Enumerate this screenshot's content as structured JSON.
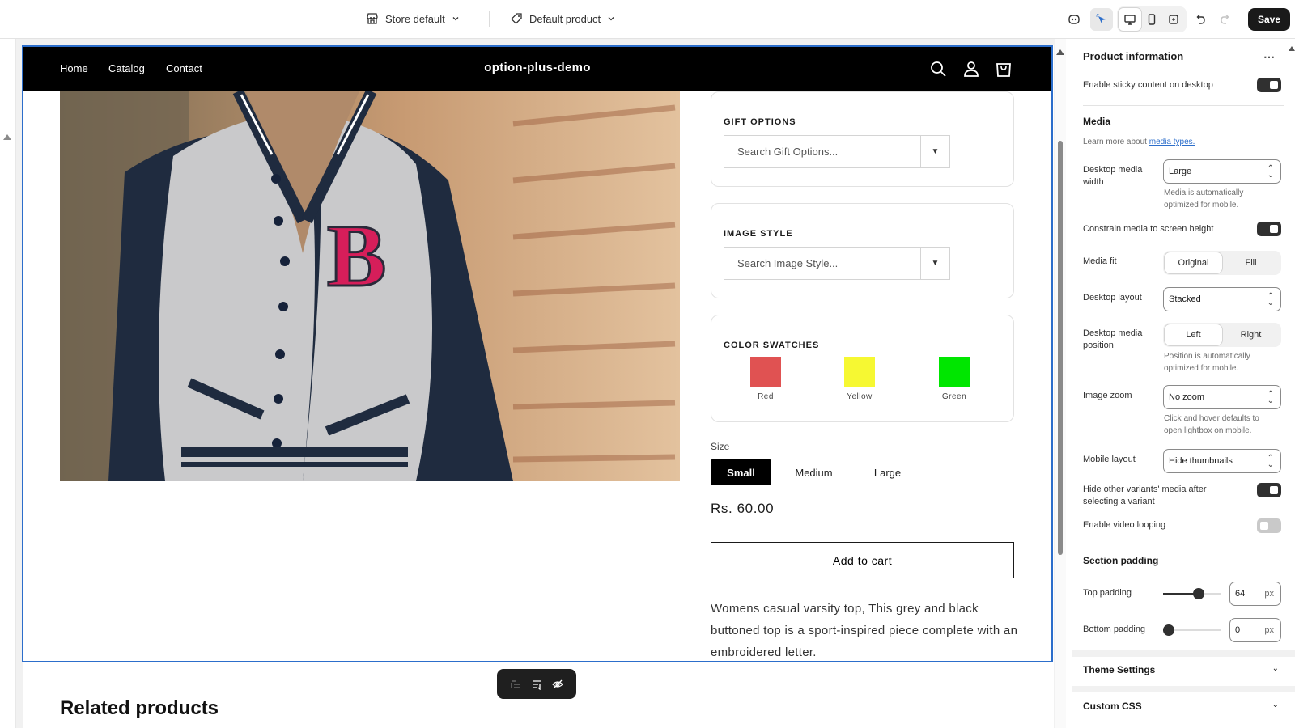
{
  "topbar": {
    "store_label": "Store default",
    "template_label": "Default product",
    "save_label": "Save"
  },
  "store": {
    "nav": [
      "Home",
      "Catalog",
      "Contact"
    ],
    "name": "option-plus-demo"
  },
  "product": {
    "gift_options": {
      "title": "GIFT OPTIONS",
      "placeholder": "Search Gift Options..."
    },
    "image_style": {
      "title": "IMAGE STYLE",
      "placeholder": "Search Image Style..."
    },
    "color_swatches": {
      "title": "COLOR SWATCHES",
      "items": [
        {
          "label": "Red",
          "color": "#e05252"
        },
        {
          "label": "Yellow",
          "color": "#f6f832"
        },
        {
          "label": "Green",
          "color": "#00e600"
        }
      ]
    },
    "size_label": "Size",
    "sizes": [
      "Small",
      "Medium",
      "Large"
    ],
    "selected_size": "Small",
    "price": "Rs. 60.00",
    "add_to_cart": "Add to cart",
    "description": "Womens casual varsity top, This grey and black buttoned top is a sport-inspired piece complete with an embroidered letter."
  },
  "related_title": "Related products",
  "panel": {
    "title": "Product information",
    "sticky_label": "Enable sticky content on desktop",
    "media_title": "Media",
    "learn_prefix": "Learn more about",
    "learn_link": "media types.",
    "desktop_media_width": {
      "label": "Desktop media width",
      "value": "Large",
      "help": "Media is automatically optimized for mobile."
    },
    "constrain_label": "Constrain media to screen height",
    "media_fit": {
      "label": "Media fit",
      "options": [
        "Original",
        "Fill"
      ],
      "selected": "Original"
    },
    "desktop_layout": {
      "label": "Desktop layout",
      "value": "Stacked"
    },
    "desktop_media_position": {
      "label": "Desktop media position",
      "options": [
        "Left",
        "Right"
      ],
      "selected": "Left",
      "help": "Position is automatically optimized for mobile."
    },
    "image_zoom": {
      "label": "Image zoom",
      "value": "No zoom",
      "help": "Click and hover defaults to open lightbox on mobile."
    },
    "mobile_layout": {
      "label": "Mobile layout",
      "value": "Hide thumbnails"
    },
    "hide_variants_label": "Hide other variants' media after selecting a variant",
    "video_looping_label": "Enable video looping",
    "section_padding_title": "Section padding",
    "top_padding": {
      "label": "Top padding",
      "value": "64",
      "unit": "px",
      "level": 0.64
    },
    "bottom_padding": {
      "label": "Bottom padding",
      "value": "0",
      "unit": "px",
      "level": 0
    },
    "theme_settings": "Theme Settings",
    "custom_css": "Custom CSS"
  },
  "colors": {
    "accent": "#2c6ecb",
    "toggle_on": "#303030",
    "toggle_off": "#c9c9c9"
  }
}
